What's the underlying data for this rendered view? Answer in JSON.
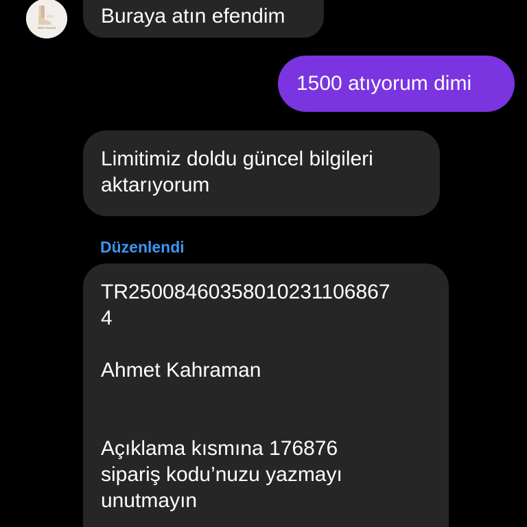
{
  "conversation": {
    "avatar": {
      "icon": "shop-logo-icon",
      "logo_text": "NEREO FASHION"
    },
    "messages": [
      {
        "direction": "incoming",
        "lines": [
          "Buraya atın efendim"
        ]
      },
      {
        "direction": "outgoing",
        "lines": [
          "1500 atıyorum dimi"
        ]
      },
      {
        "direction": "incoming",
        "lines": [
          "Limitimiz doldu güncel bilgileri",
          "aktarıyorum"
        ]
      },
      {
        "direction": "incoming",
        "edited_label": "Düzenlendi",
        "lines": [
          "TR25008460358010231106867",
          "4",
          "",
          "Ahmet Kahraman",
          "",
          "",
          "Açıklama kısmına 176876",
          "sipariş kodu’nuzu yazmayı",
          "unutmayın"
        ]
      }
    ]
  },
  "colors": {
    "background": "#000000",
    "incoming_bubble": "#262626",
    "outgoing_bubble": "#7b35e0",
    "edited_label": "#3b97f3",
    "text": "#ffffff"
  }
}
